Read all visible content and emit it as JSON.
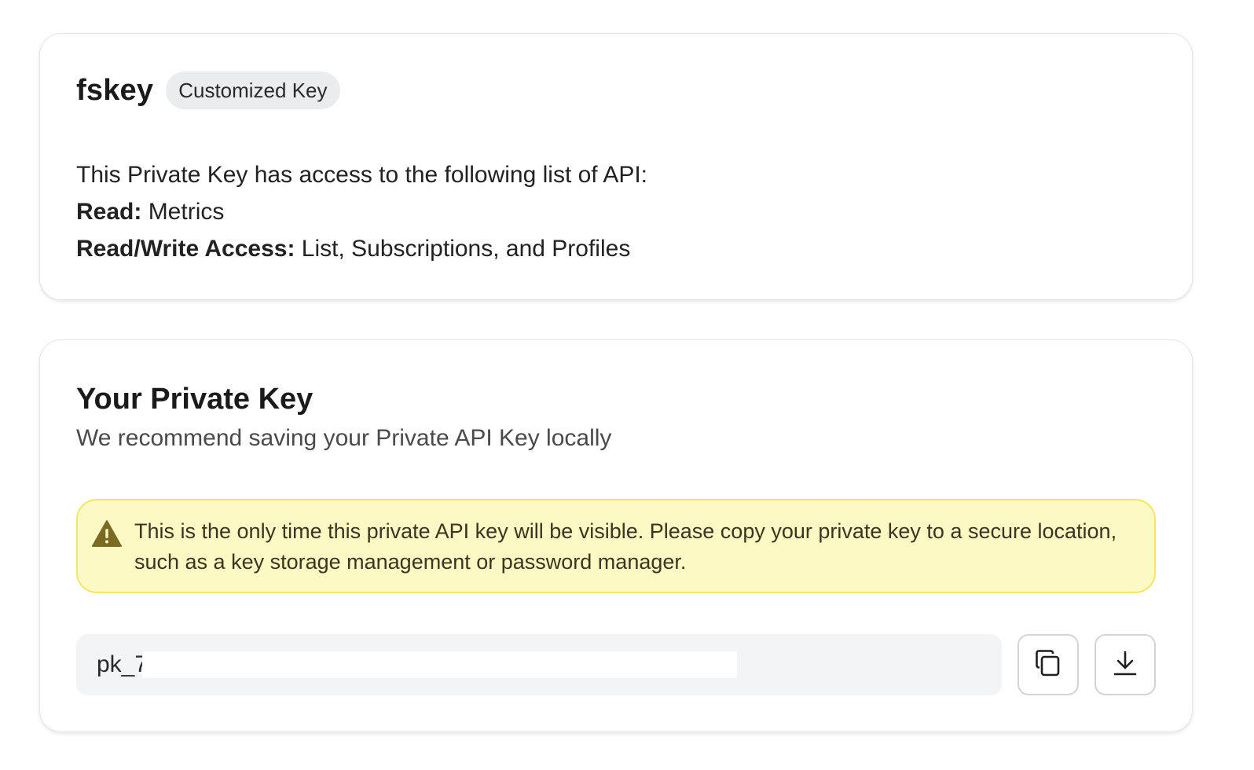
{
  "key_info": {
    "name": "fskey",
    "badge": "Customized Key",
    "access_intro": "This Private Key has access to the following list of API:",
    "read_label": "Read:",
    "read_value": " Metrics",
    "readwrite_label": "Read/Write Access:",
    "readwrite_value": " List, Subscriptions, and Profiles"
  },
  "private_key": {
    "title": "Your Private Key",
    "subtitle": "We recommend saving your Private API Key locally",
    "warning": "This is the only time this private API key will be visible. Please copy your private key to a secure location, such as a key storage management or password manager.",
    "key_value": "pk_7",
    "copy_icon": "copy-icon",
    "download_icon": "download-icon"
  },
  "colors": {
    "warning_bg": "#fdf9c4",
    "warning_border": "#f0e668",
    "warning_icon": "#7a6a22",
    "field_bg": "#f3f4f6",
    "badge_bg": "#ebeced"
  }
}
